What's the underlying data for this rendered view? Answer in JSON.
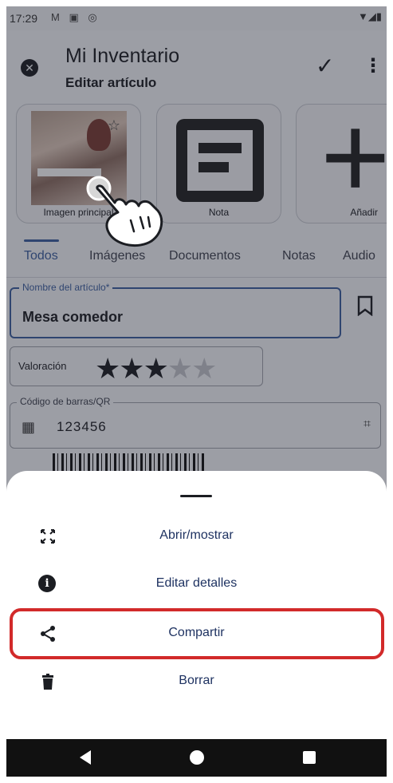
{
  "status_bar": {
    "time": "17:29",
    "notification_icons": [
      "gmail-icon",
      "photo-icon",
      "circle-icon"
    ],
    "system_icons": [
      "wifi-icon",
      "signal-icon",
      "battery-icon"
    ]
  },
  "app_bar": {
    "title": "Mi Inventario",
    "subtitle": "Editar artículo",
    "close_icon": "close-circle-icon",
    "confirm_icon": "check-icon",
    "more_icon": "more-vert-icon"
  },
  "attachments": [
    {
      "label": "Imagen principal",
      "icon": "photo-thumbnail"
    },
    {
      "label": "Nota",
      "icon": "note-icon"
    },
    {
      "label": "Añadir",
      "icon": "plus-icon"
    }
  ],
  "tabs": [
    {
      "label": "Todos",
      "active": true
    },
    {
      "label": "Imágenes",
      "active": false
    },
    {
      "label": "Documentos",
      "active": false
    },
    {
      "label": "Notas",
      "active": false
    },
    {
      "label": "Audio",
      "active": false
    }
  ],
  "form": {
    "name_label": "Nombre del artículo*",
    "name_value": "Mesa comedor",
    "rating_label": "Valoración",
    "rating": 3,
    "rating_max": 5,
    "barcode_label": "Código de barras/QR",
    "barcode_value": "123456"
  },
  "bottom_sheet": {
    "items": [
      {
        "label": "Abrir/mostrar",
        "icon": "fullscreen-icon"
      },
      {
        "label": "Editar detalles",
        "icon": "info-icon"
      },
      {
        "label": "Compartir",
        "icon": "share-icon",
        "highlighted": true
      },
      {
        "label": "Borrar",
        "icon": "trash-icon"
      }
    ]
  },
  "colors": {
    "accent": "#3b5fa0",
    "highlight": "#d22a2a",
    "menu_text": "#1e3261"
  }
}
